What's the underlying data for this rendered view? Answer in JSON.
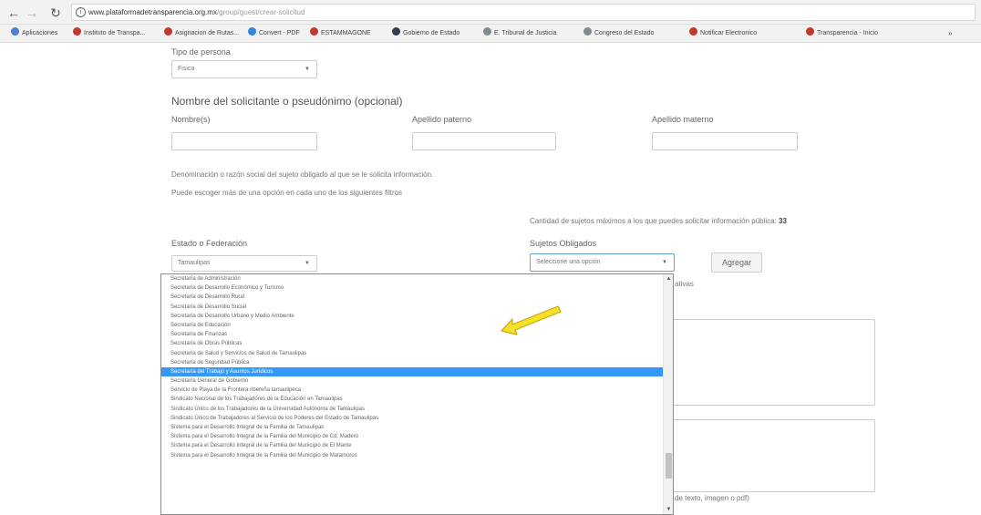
{
  "browser": {
    "url_host": "www.plataformadetransparencia.org.mx",
    "url_path": "/group/guest/crear-solicitud",
    "bookmarks": [
      {
        "label": "Aplicaciones",
        "color": "#4a7fd4"
      },
      {
        "label": "Instituto de Transpa...",
        "color": "#c0392b"
      },
      {
        "label": "Asignacion de Rutas...",
        "color": "#c0392b"
      },
      {
        "label": "Convert - PDF",
        "color": "#2e86de"
      },
      {
        "label": "ESTAMMAGONE",
        "color": "#c0392b"
      },
      {
        "label": "Gobierno de Estado",
        "color": "#2c3e50"
      },
      {
        "label": "E. Tribunal de Justicia",
        "color": "#7f8c8d"
      },
      {
        "label": "Congreso del Estado",
        "color": "#7f8c8d"
      },
      {
        "label": "Notificar Electronico",
        "color": "#c0392b"
      },
      {
        "label": "Transparencia - Inicio",
        "color": "#c0392b"
      }
    ]
  },
  "form": {
    "tipo_persona_label": "Tipo de persona",
    "tipo_persona_value": "Fisica",
    "nombre_heading": "Nombre del solicitante o pseudónimo (opcional)",
    "nombre_label": "Nombre(s)",
    "apellido_paterno_label": "Apellido paterno",
    "apellido_materno_label": "Apellido materno",
    "denominacion_text": "Denominación o razón social del sujeto obligado al que se le solicita información.",
    "escoger_text": "Puede escoger más de una opción en cada uno de los siguientes filtros",
    "cantidad_text": "Cantidad de sujetos máximos a los que puedes solicitar información pública:",
    "cantidad_value": "33",
    "estado_label": "Estado o Federación",
    "estado_value": "Tamaulipas",
    "sujetos_label": "Sujetos Obligados",
    "sujetos_value": "Seleccione una opción",
    "agregar_label": "Agregar",
    "partial_text_1": "ativas",
    "partial_text_2": "de texto, imagen o pdf)"
  },
  "dropdown": {
    "selected_index": 13,
    "options": [
      "Secretaría de Administración",
      "Secretaría de Desarrollo Económico y Turismo",
      "Secretaría de Desarrollo Rural",
      "Secretaría de Desarrollo Social",
      "Secretaría de Desarrollo Urbano y Medio Ambiente",
      "Secretaría de Educación",
      "Secretaría de Finanzas",
      "Secretaría de Obras Públicas",
      "Secretaría de Salud y Servicios de Salud de Tamaulipas",
      "Secretaría de Seguridad Pública",
      "Secretaría del Trabajo y Asuntos Jurídicos",
      "Secretaría General de Gobierno",
      "Servicio de Playa de la Frontera ribereña tamaulipeca",
      "Sindicato Nacional de los Trabajadores de la Educación en Tamaulipas",
      "Sindicato Único de los Trabajadores de la Universidad Autónoma de Tamaulipas",
      "Sindicato Único de Trabajadores al Servicio de los Poderes del Estado de Tamaulipas",
      "Sistema para el Desarrollo Integral de la Familia de Tamaulipas",
      "Sistema para el Desarrollo Integral de la Familia del Municipio de Cd. Madero",
      "Sistema para el Desarrollo Integral de la Familia del Municipio de El Mante",
      "Sistema para el Desarrollo Integral de la Familia del Municipio de Matamoros"
    ]
  },
  "annotation": {
    "arrow_color": "#f5e12a",
    "arrow_stroke": "#c9a800"
  }
}
